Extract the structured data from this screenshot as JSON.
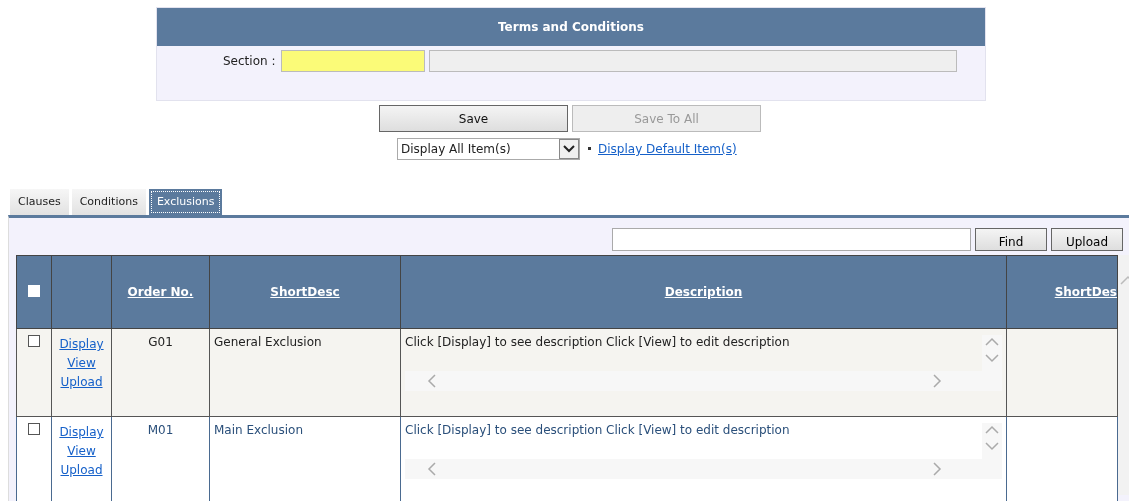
{
  "panel": {
    "title": "Terms and Conditions",
    "section_label": "Section :",
    "section_code": {
      "required": true
    }
  },
  "buttons": [
    {
      "label": "Save",
      "disabled": false
    },
    {
      "label": "Save To All",
      "disabled": true
    }
  ],
  "display_select": {
    "value": "Display All Item(s)"
  },
  "default_link": "Display Default Item(s)",
  "tabs": [
    {
      "label": "Clauses",
      "selected": false
    },
    {
      "label": "Conditions",
      "selected": false
    },
    {
      "label": "Exclusions",
      "selected": true
    }
  ],
  "search": {
    "buttons": [
      "Find",
      "Upload"
    ]
  },
  "table": {
    "select_all": false,
    "columns": [
      "Order No.",
      "ShortDesc",
      "Description",
      "ShortDes"
    ],
    "rows": [
      {
        "checked": false,
        "links": [
          "Display",
          "View",
          "Upload"
        ],
        "order_no": "G01",
        "short_desc": "General Exclusion",
        "description": "Click [Display] to see description Click [View] to edit description",
        "hovered": false
      },
      {
        "checked": false,
        "links": [
          "Display",
          "View",
          "Upload"
        ],
        "order_no": "M01",
        "short_desc": "Main Exclusion",
        "description": "Click [Display] to see description Click [View] to edit description",
        "hovered": true
      }
    ]
  }
}
